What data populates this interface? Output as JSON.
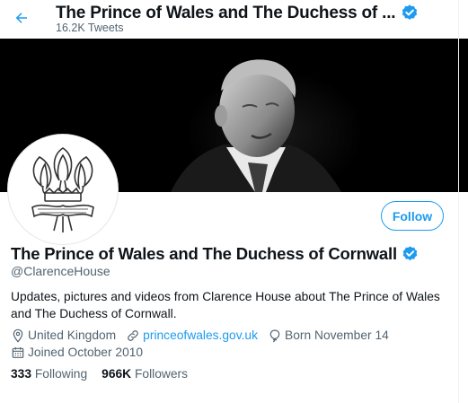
{
  "header": {
    "title": "The Prince of Wales and The Duchess of ...",
    "tweet_count": "16.2K Tweets"
  },
  "profile": {
    "name": "The Prince of Wales and The Duchess of Cornwall",
    "handle": "@ClarenceHouse",
    "bio": "Updates, pictures and videos from Clarence House about The Prince of Wales and The Duchess of Cornwall.",
    "location": "United Kingdom",
    "website": "princeofwales.gov.uk",
    "birthday": "Born November 14",
    "joined": "Joined October 2010",
    "follow_label": "Follow"
  },
  "stats": {
    "following_count": "333",
    "following_label": "Following",
    "followers_count": "966K",
    "followers_label": "Followers"
  },
  "colors": {
    "accent": "#1d9bf0",
    "secondary_text": "#536471",
    "banner_bg": "#000000"
  }
}
